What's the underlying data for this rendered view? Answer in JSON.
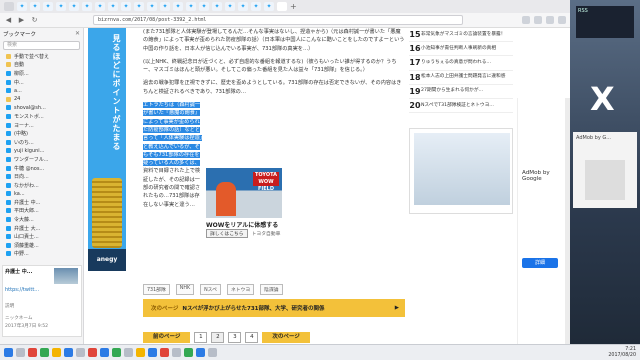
{
  "browser": {
    "url": "bizrnva.com/2017/08/post-3392_2.html",
    "back": "◀",
    "forward": "▶",
    "reload": "↻",
    "newtab": "+"
  },
  "sidebar": {
    "title": "ブックマーク",
    "close": "✕",
    "search_placeholder": "検索",
    "items": [
      {
        "label": "手動で並べ替え",
        "icon": "folder"
      },
      {
        "label": "自動",
        "icon": "folder"
      },
      {
        "label": "柳原...",
        "icon": "tw"
      },
      {
        "label": "中...",
        "icon": "tw"
      },
      {
        "label": "a...",
        "icon": "tw"
      },
      {
        "label": "24",
        "icon": "folder"
      },
      {
        "label": "shoval@sh...",
        "icon": "tw"
      },
      {
        "label": "モンストボ...",
        "icon": "tw"
      },
      {
        "label": "ヨーナ...",
        "icon": "tw"
      },
      {
        "label": "(中略)",
        "icon": "tw"
      },
      {
        "label": "いのち...",
        "icon": "tw"
      },
      {
        "label": "yuji kiguni...",
        "icon": "tw"
      },
      {
        "label": "ワンダーフル...",
        "icon": "tw"
      },
      {
        "label": "牛糖 @nos...",
        "icon": "tw"
      },
      {
        "label": "日向...",
        "icon": "tw"
      },
      {
        "label": "なかがわ...",
        "icon": "tw"
      },
      {
        "label": "ka...",
        "icon": "tw"
      },
      {
        "label": "弁護士 中...",
        "icon": "tw"
      },
      {
        "label": "平田大郎...",
        "icon": "tw"
      },
      {
        "label": "令大藤...",
        "icon": "tw"
      },
      {
        "label": "弁護士 大...",
        "icon": "tw"
      },
      {
        "label": "山口責士...",
        "icon": "tw"
      },
      {
        "label": "須藤重雄...",
        "icon": "tw"
      },
      {
        "label": "中野...",
        "icon": "tw"
      }
    ],
    "count": "24",
    "preview": {
      "title": "弁護士 中...",
      "link": "https://twitt...",
      "label": "説明",
      "tag_label": "ニックネーム",
      "date": "2017年3月7日 9:52"
    }
  },
  "left_ad": {
    "text": "見るほどにポイントがたまる",
    "footer": "anegy"
  },
  "article": {
    "p1": "(また731部隊と人体実験が登場してるんだ…そんな事実はないし、捏造ゃから)（元は森村誠一が書いた「悪魔の飽食」によって事実が歪められた防疫部隊の話）（日本軍は中国人にこんなに酷いことをしたのですよーという中国の作り話を、日本人が信じ込んでいる事実が、731部隊の真実を…）",
    "p2": "(以上NHK、終戦記念日が近づくと、必ず自虐的な番組を報道するな)（彼らもいったい誰が得するのか？うちー、マスゴミはほんと頭が悪い。そしてこの偏った番組を見た人は益々「731部隊」を信じる。）",
    "p3": "過去の戦争犯罪を正視できずに、歴史を歪めようとしている。731部隊の存在は否定できないが、その内容はきちんと検証されるべきであり、731部隊の…",
    "p4_highlight": "エトラたちは（森村誠一が書いた『悪魔の飽食』によって事実が歪められた防疫部隊の話）などと言って「人体実験は捏造」と教え込んでいるが、そもそも731部隊の存在を疑っている人の多くは、",
    "p4_rest": "資料で目録された上で検証したが、その記録は一部の研究者の間で確認されたもの…731部隊は存在しない事実と違う…",
    "p5": "とりわけ人体実験の有無については、奥塚家政夫の意見をはじめとする保守派の歴史学者でも異論を呈示したものとは言え…",
    "p6": "しかし、これは言いたいが、エトラさんの論調は、こんな痛烈なノリのいちゃもんにしかつけられていない。今回の「Nスペ」のネタが流れたようなことでもある。しかし、同番組を呆れた学者の中には…",
    "p7": "そもそも、また、現在の安倍首相が推し進める「軍学共同」につながる問題だった。"
  },
  "photo": {
    "logo": "TOYOTA WOW FIELD",
    "caption": "WOWをリアルに体感する場所とは？",
    "button": "詳しくはこちら",
    "sponsor": "トヨタ自動車"
  },
  "tags": [
    "731部隊",
    "NHK",
    "Nスペ",
    "ネトウヨ",
    "陰謀論"
  ],
  "next": {
    "label": "次のページ",
    "title": "Nスペが浮かび上がらせた731部隊、大学、研究者の関係",
    "arrow": "▶"
  },
  "pager": {
    "prev": "前のページ",
    "pages": [
      "1",
      "2",
      "3",
      "4"
    ],
    "current": "2",
    "next": "次のページ"
  },
  "ranking": [
    {
      "n": "15",
      "t": "非常気象がマスゴミの言論装置を暴露！"
    },
    {
      "n": "16",
      "t": "小池知事が責任判断人事刷新の真相"
    },
    {
      "n": "17",
      "t": "りゅうちぇるの真意が問われる…"
    },
    {
      "n": "18",
      "t": "松本人志の上田弁護士問題発言に違和感"
    },
    {
      "n": "19",
      "t": "27期間から生まれる何かが…"
    },
    {
      "n": "20",
      "t": "NスペでT31部隊検証とネトウヨ…"
    }
  ],
  "right_ad": {
    "adby": "AdMob by Google",
    "btn": "詳細"
  },
  "desktop": {
    "clock_text": "RSS",
    "panel_head": "AdMob by G..."
  },
  "taskbar": {
    "time": "7:21",
    "date": "2017/08/20"
  }
}
